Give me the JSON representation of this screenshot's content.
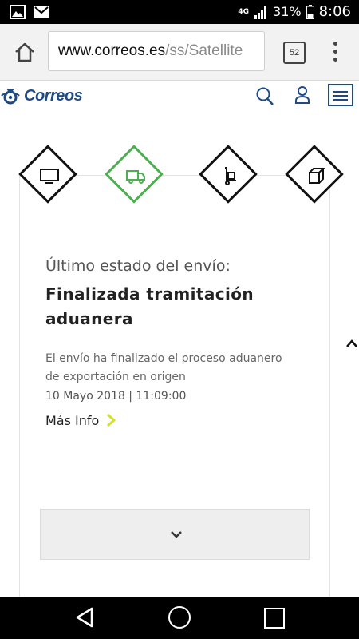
{
  "statusbar": {
    "network": "4G",
    "battery": "31%",
    "time": "8:06"
  },
  "browser": {
    "url_host": "www.correos.es",
    "url_path": "/ss/Satellite",
    "tab_count": "52"
  },
  "site": {
    "logo_text": "Correos"
  },
  "steps": [
    {
      "icon": "monitor-icon",
      "color": "#111111"
    },
    {
      "icon": "truck-icon",
      "color": "#4caf50"
    },
    {
      "icon": "hand-truck-icon",
      "color": "#111111"
    },
    {
      "icon": "package-icon",
      "color": "#111111"
    }
  ],
  "shipment": {
    "state_label": "Último estado del envío:",
    "state_title": "Finalizada tramitación aduanera",
    "description": "El envío ha finalizado el proceso aduanero de exportación en origen",
    "date": "10 Mayo 2018 | 11:09:00",
    "more_info": "Más Info"
  },
  "colors": {
    "brand": "#1f4a86",
    "active_step": "#4caf50",
    "more_info_arrow": "#d4e030"
  }
}
